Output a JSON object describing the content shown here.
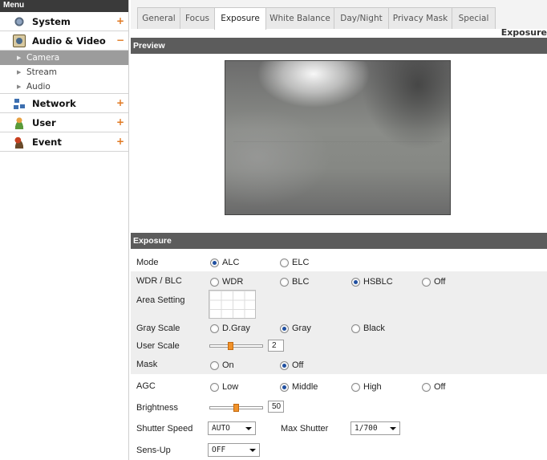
{
  "sidebar": {
    "header": "Menu",
    "items": [
      {
        "label": "System",
        "toggle": "+"
      },
      {
        "label": "Audio & Video",
        "toggle": "−"
      },
      {
        "label": "Network",
        "toggle": "+"
      },
      {
        "label": "User",
        "toggle": "+"
      },
      {
        "label": "Event",
        "toggle": "+"
      }
    ],
    "subitems": [
      "Camera",
      "Stream",
      "Audio"
    ]
  },
  "tabs": {
    "items": [
      "General",
      "Focus",
      "Exposure",
      "White Balance",
      "Day/Night",
      "Privacy Mask",
      "Special"
    ],
    "active": "Exposure",
    "caption": "Exposure"
  },
  "preview": {
    "header": "Preview"
  },
  "exposure": {
    "header": "Exposure",
    "mode": {
      "label": "Mode",
      "options": [
        "ALC",
        "ELC"
      ],
      "selected": "ALC"
    },
    "wdr": {
      "label": "WDR / BLC",
      "options": [
        "WDR",
        "BLC",
        "HSBLC",
        "Off"
      ],
      "selected": "HSBLC"
    },
    "area": {
      "label": "Area Setting"
    },
    "gray_scale": {
      "label": "Gray Scale",
      "options": [
        "D.Gray",
        "Gray",
        "Black"
      ],
      "selected": "Gray"
    },
    "user_scale": {
      "label": "User Scale",
      "value": "2",
      "fraction": 0.38
    },
    "mask": {
      "label": "Mask",
      "options": [
        "On",
        "Off"
      ],
      "selected": "Off"
    },
    "agc": {
      "label": "AGC",
      "options": [
        "Low",
        "Middle",
        "High",
        "Off"
      ],
      "selected": "Middle"
    },
    "brightness": {
      "label": "Brightness",
      "value": "50",
      "fraction": 0.5
    },
    "shutter_speed": {
      "label": "Shutter Speed",
      "value": "AUTO"
    },
    "max_shutter": {
      "label": "Max Shutter",
      "value": "1/700"
    },
    "sens_up": {
      "label": "Sens-Up",
      "value": "OFF"
    }
  },
  "colors": {
    "accent": "#f0922a",
    "header_bg": "#5c5c5c",
    "active_sub": "#9c9c9c"
  }
}
